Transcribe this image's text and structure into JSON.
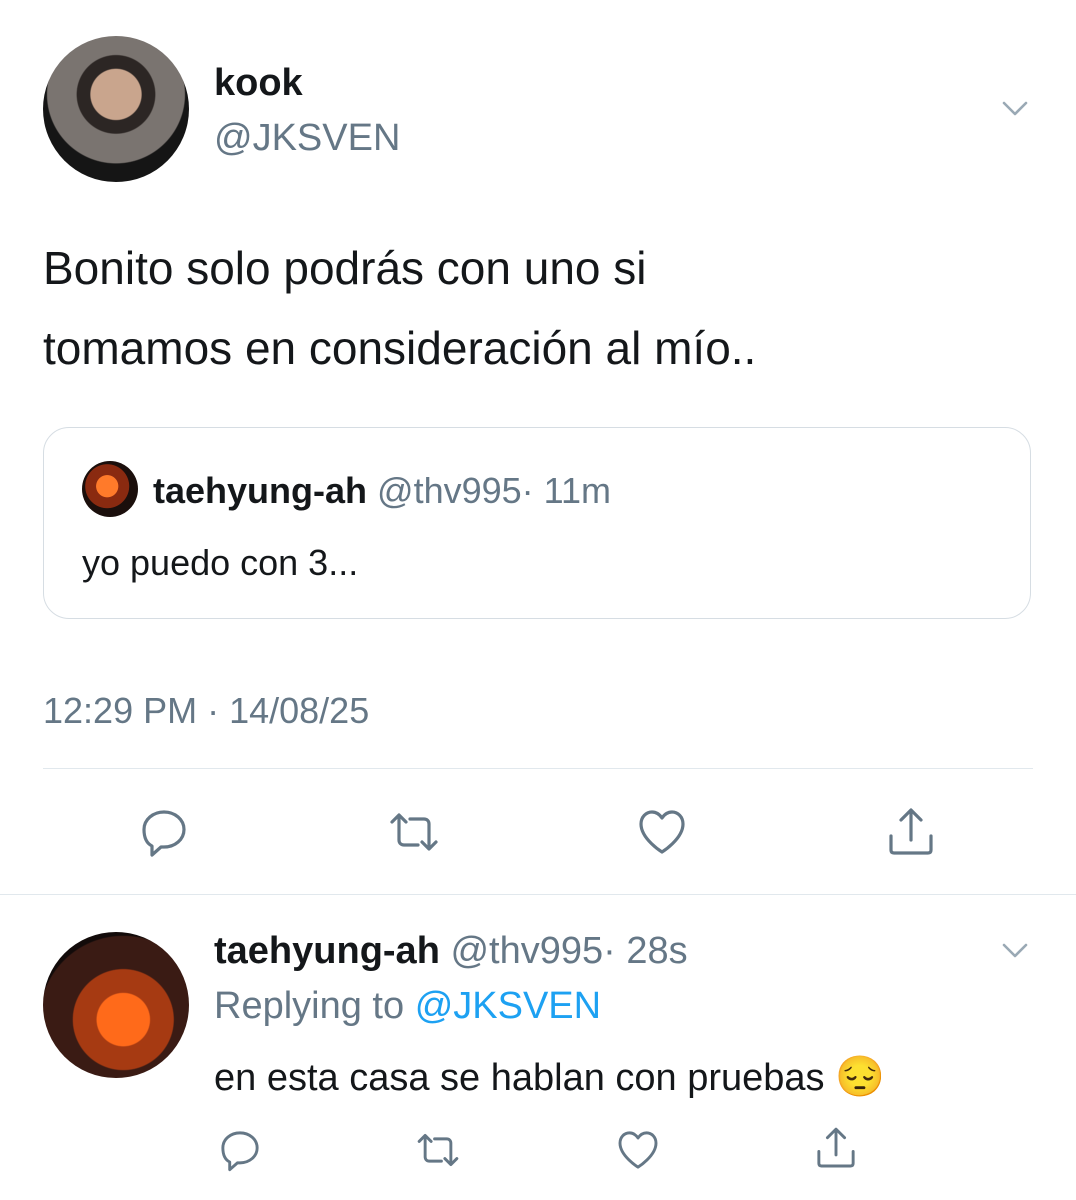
{
  "tweet": {
    "author_name": "kook",
    "author_handle": "@JKSVEN",
    "text_line1": "Bonito solo podrás con uno si",
    "text_line2": "tomamos en consideración al mío..",
    "timestamp": "12:29 PM · 14/08/25"
  },
  "quoted": {
    "author_name": "taehyung-ah",
    "author_handle": "@thv995",
    "time": "· 11m",
    "text": "yo puedo con 3..."
  },
  "reply": {
    "author_name": "taehyung-ah",
    "author_handle": "@thv995",
    "time": "· 28s",
    "replying_prefix": "Replying to",
    "replying_handle": "@JKSVEN",
    "text": "en esta casa se hablan con pruebas",
    "emoji": "😔"
  },
  "icons": {
    "reply": "reply-icon",
    "retweet": "retweet-icon",
    "like": "heart-icon",
    "share": "share-icon",
    "menu": "chevron-down-icon"
  },
  "colors": {
    "text": "#14171a",
    "secondary": "#657786",
    "link": "#1da1f2",
    "border": "#e1e8ed"
  }
}
